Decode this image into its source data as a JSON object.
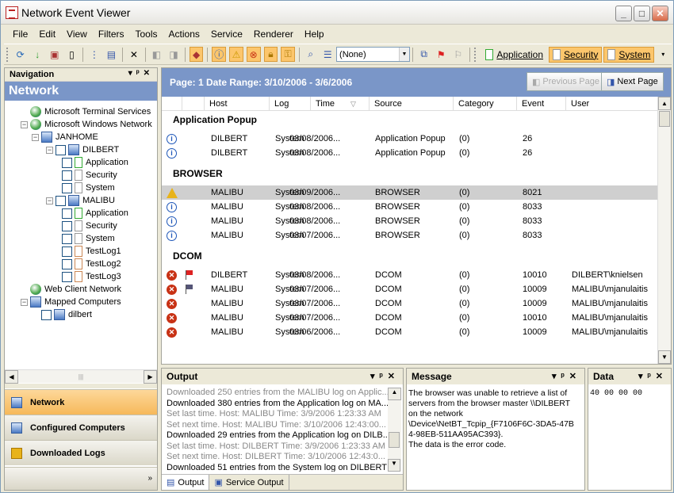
{
  "window": {
    "title": "Network Event Viewer"
  },
  "menu": [
    "File",
    "Edit",
    "View",
    "Filters",
    "Tools",
    "Actions",
    "Service",
    "Renderer",
    "Help"
  ],
  "toolbar": {
    "filter_combo": "(None)",
    "logs": [
      "Application",
      "Security",
      "System"
    ]
  },
  "nav": {
    "pane_title": "Navigation",
    "header": "Network",
    "tree": [
      {
        "label": "Microsoft Terminal Services",
        "icon": "globe-icon",
        "depth": 0
      },
      {
        "label": "Microsoft Windows Network",
        "icon": "globe-icon",
        "depth": 0
      },
      {
        "label": "JANHOME",
        "icon": "computer-group-icon",
        "depth": 1
      },
      {
        "label": "DILBERT",
        "icon": "computer-icon",
        "depth": 2
      },
      {
        "label": "Application",
        "icon": "log-icon",
        "depth": 3
      },
      {
        "label": "Security",
        "icon": "log-icon",
        "depth": 3
      },
      {
        "label": "System",
        "icon": "log-icon",
        "depth": 3
      },
      {
        "label": "MALIBU",
        "icon": "computer-icon",
        "depth": 2
      },
      {
        "label": "Application",
        "icon": "log-icon",
        "depth": 3
      },
      {
        "label": "Security",
        "icon": "log-icon",
        "depth": 3
      },
      {
        "label": "System",
        "icon": "log-icon",
        "depth": 3
      },
      {
        "label": "TestLog1",
        "icon": "log-icon",
        "depth": 3
      },
      {
        "label": "TestLog2",
        "icon": "log-icon",
        "depth": 3
      },
      {
        "label": "TestLog3",
        "icon": "log-icon",
        "depth": 3
      },
      {
        "label": "Web Client Network",
        "icon": "globe-icon",
        "depth": 0
      },
      {
        "label": "Mapped Computers",
        "icon": "computer-group-icon",
        "depth": 0
      },
      {
        "label": "dilbert",
        "icon": "computer-icon",
        "depth": 1
      }
    ],
    "buttons": [
      "Network",
      "Configured Computers",
      "Downloaded Logs"
    ]
  },
  "main": {
    "page_info": "Page: 1 Date Range: 3/10/2006 - 3/6/2006",
    "prev_label": "Previous Page",
    "next_label": "Next Page",
    "columns": [
      "Host",
      "Log",
      "Time",
      "Source",
      "Category",
      "Event",
      "User"
    ],
    "groups": [
      {
        "name": "Application Popup",
        "rows": [
          {
            "type": "info",
            "host": "DILBERT",
            "log": "System",
            "time": "03/08/2006...",
            "source": "Application Popup",
            "category": "(0)",
            "event": "26",
            "user": ""
          },
          {
            "type": "info",
            "host": "DILBERT",
            "log": "System",
            "time": "03/08/2006...",
            "source": "Application Popup",
            "category": "(0)",
            "event": "26",
            "user": ""
          }
        ]
      },
      {
        "name": "BROWSER",
        "rows": [
          {
            "type": "warn",
            "host": "MALIBU",
            "log": "System",
            "time": "03/09/2006...",
            "source": "BROWSER",
            "category": "(0)",
            "event": "8021",
            "user": "",
            "selected": true
          },
          {
            "type": "info",
            "host": "MALIBU",
            "log": "System",
            "time": "03/08/2006...",
            "source": "BROWSER",
            "category": "(0)",
            "event": "8033",
            "user": ""
          },
          {
            "type": "info",
            "host": "MALIBU",
            "log": "System",
            "time": "03/08/2006...",
            "source": "BROWSER",
            "category": "(0)",
            "event": "8033",
            "user": ""
          },
          {
            "type": "info",
            "host": "MALIBU",
            "log": "System",
            "time": "03/07/2006...",
            "source": "BROWSER",
            "category": "(0)",
            "event": "8033",
            "user": ""
          }
        ]
      },
      {
        "name": "DCOM",
        "rows": [
          {
            "type": "err",
            "flag": "red",
            "host": "DILBERT",
            "log": "System",
            "time": "03/08/2006...",
            "source": "DCOM",
            "category": "(0)",
            "event": "10010",
            "user": "DILBERT\\knielsen"
          },
          {
            "type": "err",
            "flag": "blue",
            "host": "MALIBU",
            "log": "System",
            "time": "03/07/2006...",
            "source": "DCOM",
            "category": "(0)",
            "event": "10009",
            "user": "MALIBU\\mjanulaitis"
          },
          {
            "type": "err",
            "host": "MALIBU",
            "log": "System",
            "time": "03/07/2006...",
            "source": "DCOM",
            "category": "(0)",
            "event": "10009",
            "user": "MALIBU\\mjanulaitis"
          },
          {
            "type": "err",
            "host": "MALIBU",
            "log": "System",
            "time": "03/07/2006...",
            "source": "DCOM",
            "category": "(0)",
            "event": "10010",
            "user": "MALIBU\\mjanulaitis"
          },
          {
            "type": "err",
            "host": "MALIBU",
            "log": "System",
            "time": "03/06/2006...",
            "source": "DCOM",
            "category": "(0)",
            "event": "10009",
            "user": "MALIBU\\mjanulaitis"
          }
        ]
      }
    ]
  },
  "output": {
    "title": "Output",
    "lines": [
      {
        "t": "Downloaded 250 entries from the MALIBU log on Applic...",
        "g": true
      },
      {
        "t": "Downloaded 380 entries from the Application log on MA...",
        "g": false
      },
      {
        "t": "Set last time. Host: MALIBU Time: 3/9/2006 1:23:33 AM",
        "g": true
      },
      {
        "t": "Set next time. Host: MALIBU Time: 3/10/2006 12:43:00...",
        "g": true
      },
      {
        "t": "Downloaded 29 entries from the Application log on DILB...",
        "g": false
      },
      {
        "t": "Set last time. Host: DILBERT Time: 3/9/2006 1:23:33 AM",
        "g": true
      },
      {
        "t": "Set next time. Host: DILBERT Time: 3/10/2006 12:43:0...",
        "g": true
      },
      {
        "t": "Downloaded 51 entries from the System log on DILBERT",
        "g": false
      }
    ],
    "tabs": [
      "Output",
      "Service Output"
    ]
  },
  "message": {
    "title": "Message",
    "text": [
      "The browser was unable to retrieve a list of",
      "servers from the browser master \\\\DILBERT",
      "on the network",
      "\\Device\\NetBT_Tcpip_{F7106F6C-3DA5-47B",
      "4-98EB-511AA95AC393}.",
      "The data is the error code."
    ]
  },
  "data_panel": {
    "title": "Data",
    "hex": "40 00 00 00"
  }
}
